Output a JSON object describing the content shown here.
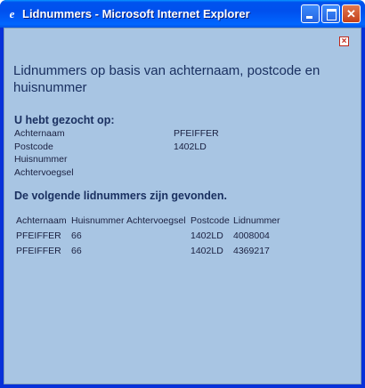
{
  "window": {
    "title": "Lidnummers - Microsoft Internet Explorer"
  },
  "page": {
    "heading": "Lidnummers op basis van achternaam, postcode en huisnummer",
    "search_heading": "U hebt gezocht op:",
    "criteria": [
      {
        "label": "Achternaam",
        "value": "PFEIFFER"
      },
      {
        "label": "Postcode",
        "value": "1402LD"
      },
      {
        "label": "Huisnummer",
        "value": ""
      },
      {
        "label": "Achtervoegsel",
        "value": ""
      }
    ],
    "results_heading": "De volgende lidnummers zijn gevonden.",
    "results": {
      "columns": [
        "Achternaam",
        "Huisnummer",
        "Achtervoegsel",
        "Postcode",
        "Lidnummer"
      ],
      "rows": [
        [
          "PFEIFFER",
          "66",
          "",
          "1402LD",
          "4008004"
        ],
        [
          "PFEIFFER",
          "66",
          "",
          "1402LD",
          "4369217"
        ]
      ]
    }
  },
  "icons": {
    "app": "internet-explorer-icon",
    "close_page": "close-icon"
  },
  "colors": {
    "titlebar": "#0054e3",
    "page_background": "#a8c5e3",
    "text": "#1a3060",
    "close_link": "#c0281a"
  }
}
